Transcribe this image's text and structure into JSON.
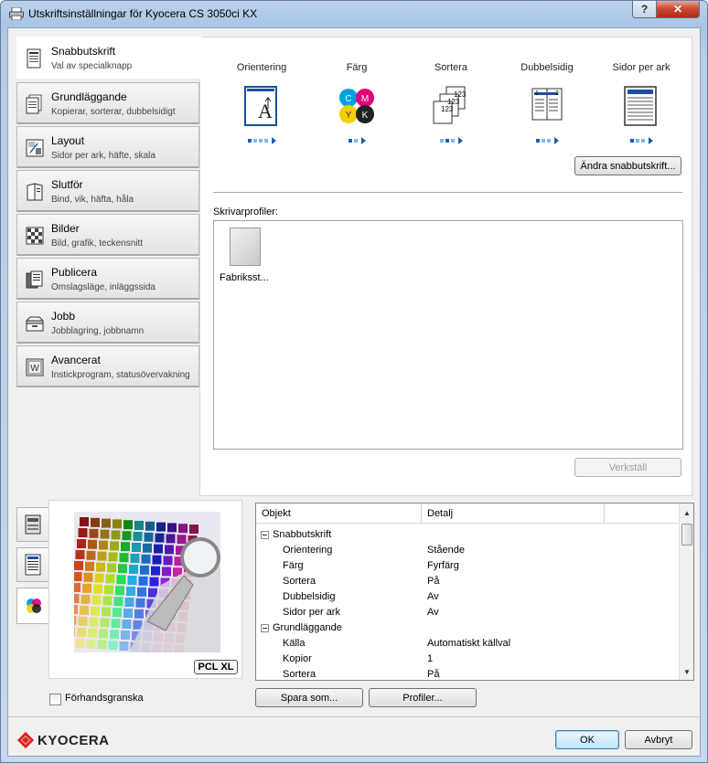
{
  "window": {
    "title": "Utskriftsinställningar för Kyocera CS 3050ci KX",
    "help_glyph": "?",
    "close_glyph": "✕"
  },
  "nav": [
    {
      "name": "Snabbutskrift",
      "sub": "Val av specialknapp",
      "icon": "quick-print-icon"
    },
    {
      "name": "Grundläggande",
      "sub": "Kopierar, sorterar, dubbelsidigt",
      "icon": "basic-icon"
    },
    {
      "name": "Layout",
      "sub": "Sidor per ark, häfte, skala",
      "icon": "layout-icon"
    },
    {
      "name": "Slutför",
      "sub": "Bind, vik, häfta, håla",
      "icon": "finishing-icon"
    },
    {
      "name": "Bilder",
      "sub": "Bild, grafik, teckensnitt",
      "icon": "imaging-icon"
    },
    {
      "name": "Publicera",
      "sub": "Omslagsläge, inläggssida",
      "icon": "publishing-icon"
    },
    {
      "name": "Jobb",
      "sub": "Jobblagring, jobbnamn",
      "icon": "job-icon"
    },
    {
      "name": "Avancerat",
      "sub": "Instickprogram, statusövervakning",
      "icon": "advanced-icon"
    }
  ],
  "quick": {
    "options": [
      {
        "label": "Orientering",
        "icon": "orientation-portrait-icon",
        "dots": 4,
        "selected": 0
      },
      {
        "label": "Färg",
        "icon": "color-cmyk-icon",
        "dots": 2,
        "selected": 0
      },
      {
        "label": "Sortera",
        "icon": "collate-icon",
        "dots": 3,
        "selected": 1
      },
      {
        "label": "Dubbelsidig",
        "icon": "duplex-icon",
        "dots": 3,
        "selected": 0
      },
      {
        "label": "Sidor per ark",
        "icon": "pages-per-sheet-icon",
        "dots": 3,
        "selected": 0
      }
    ],
    "cmyk": {
      "c": "C",
      "m": "M",
      "y": "Y",
      "k": "K"
    },
    "edit_button": "Ändra snabbutskrift...",
    "profiles_label": "Skrivarprofiler:",
    "profile_name": "Fabrikss​t...",
    "apply_button": "Verkställ"
  },
  "preview": {
    "badge": "PCL XL",
    "checkbox_label": "Förhandsgranska"
  },
  "settings_grid": {
    "columns": [
      "Objekt",
      "Detalj"
    ],
    "rows": [
      {
        "key": "Snabbutskrift",
        "value": "",
        "group": true
      },
      {
        "key": "Orientering",
        "value": "Stående",
        "group": false
      },
      {
        "key": "Färg",
        "value": "Fyrfärg",
        "group": false
      },
      {
        "key": "Sortera",
        "value": "På",
        "group": false
      },
      {
        "key": "Dubbelsidig",
        "value": "Av",
        "group": false
      },
      {
        "key": "Sidor per ark",
        "value": "Av",
        "group": false
      },
      {
        "key": "Grundläggande",
        "value": "",
        "group": true
      },
      {
        "key": "Källa",
        "value": "Automatiskt källval",
        "group": false
      },
      {
        "key": "Kopior",
        "value": "1",
        "group": false
      },
      {
        "key": "Sortera",
        "value": "På",
        "group": false
      }
    ]
  },
  "footer": {
    "save_as_button": "Spara som...",
    "profiles_button": "Profiler...",
    "ok_button": "OK",
    "cancel_button": "Avbryt",
    "logo_text": "KYOCERA"
  },
  "colors": {
    "accent": "#1a5fb4",
    "accent_light": "#7fb6e8",
    "kyocera_red": "#d7261e"
  }
}
